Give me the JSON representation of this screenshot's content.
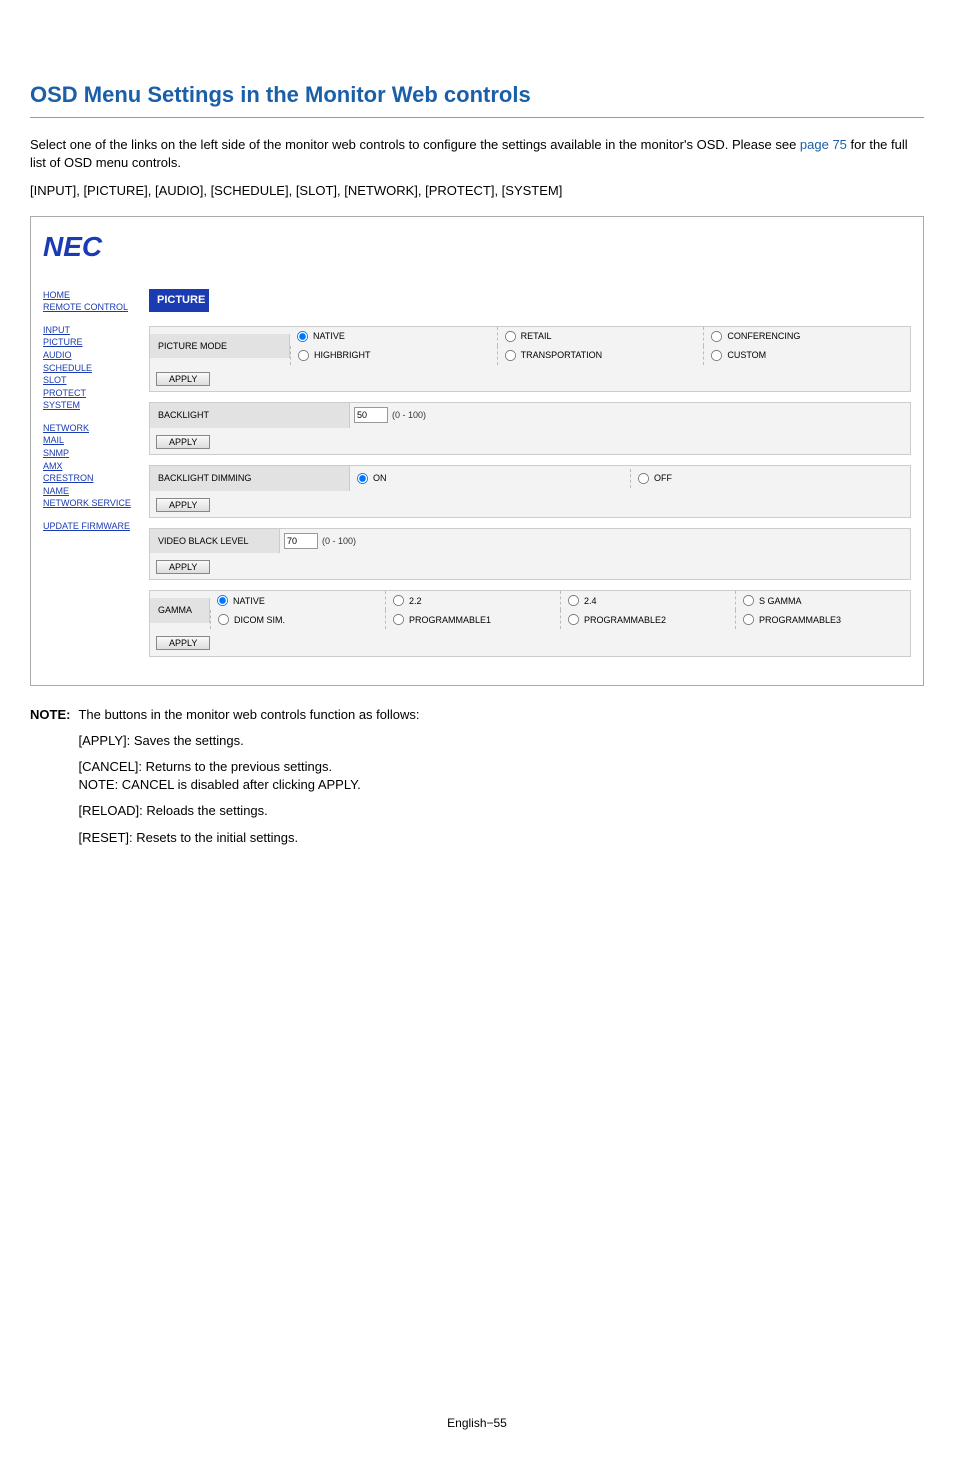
{
  "page": {
    "heading": "OSD Menu Settings in the Monitor Web controls",
    "intro_pre": "Select one of the links on the left side of the monitor web controls to configure the settings available in the monitor's OSD. Please see ",
    "page_link": "page 75",
    "intro_post": " for the full list of OSD menu controls.",
    "bracket_line": "[INPUT], [PICTURE], [AUDIO], [SCHEDULE], [SLOT], [NETWORK], [PROTECT], [SYSTEM]",
    "footer": "English−55"
  },
  "note": {
    "label": "NOTE:",
    "lines": [
      "The buttons in the monitor web controls function as follows:",
      "[APPLY]: Saves the settings.",
      "[CANCEL]: Returns to the previous settings.\nNOTE: CANCEL is disabled after clicking APPLY.",
      "[RELOAD]: Reloads the settings.",
      "[RESET]: Resets to the initial settings."
    ]
  },
  "web": {
    "logo": "NEC",
    "sidebar": {
      "group1": [
        "HOME",
        "REMOTE CONTROL"
      ],
      "group2": [
        "INPUT",
        "PICTURE",
        "AUDIO",
        "SCHEDULE",
        "SLOT",
        "PROTECT",
        "SYSTEM"
      ],
      "group3": [
        "NETWORK",
        "MAIL",
        "SNMP",
        "AMX",
        "CRESTRON",
        "NAME",
        "NETWORK SERVICE"
      ],
      "group4": [
        "UPDATE FIRMWARE"
      ]
    },
    "title": "PICTURE",
    "apply_label": "APPLY",
    "picture_mode": {
      "label": "PICTURE MODE",
      "options": [
        "NATIVE",
        "RETAIL",
        "CONFERENCING",
        "HIGHBRIGHT",
        "TRANSPORTATION",
        "CUSTOM"
      ],
      "selected": "NATIVE"
    },
    "backlight": {
      "label": "BACKLIGHT",
      "value": "50",
      "range": "(0 - 100)"
    },
    "backlight_dimming": {
      "label": "BACKLIGHT DIMMING",
      "options": [
        "ON",
        "OFF"
      ],
      "selected": "ON"
    },
    "video_black_level": {
      "label": "VIDEO BLACK LEVEL",
      "value": "70",
      "range": "(0 - 100)"
    },
    "gamma": {
      "label": "GAMMA",
      "options_row1": [
        "NATIVE",
        "2.2",
        "2.4",
        "S GAMMA"
      ],
      "options_row2": [
        "DICOM SIM.",
        "PROGRAMMABLE1",
        "PROGRAMMABLE2",
        "PROGRAMMABLE3"
      ],
      "selected": "NATIVE"
    }
  }
}
